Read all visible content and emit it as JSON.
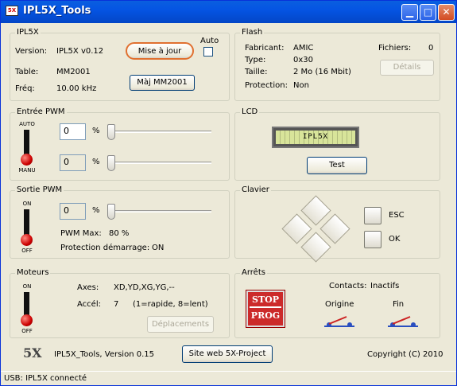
{
  "window": {
    "title": "IPL5X_Tools",
    "icon": "app-5x-icon"
  },
  "ipl5x": {
    "legend": "IPL5X",
    "version_label": "Version:",
    "version_value": "IPL5X v0.12",
    "update_button": "Mise à jour",
    "auto_label": "Auto",
    "auto_checked": false,
    "table_label": "Table:",
    "table_value": "MM2001",
    "freq_label": "Fréq:",
    "freq_value": "10.00 kHz",
    "maj_button": "Màj MM2001"
  },
  "flash": {
    "legend": "Flash",
    "fabricant_label": "Fabricant:",
    "fabricant_value": "AMIC",
    "type_label": "Type:",
    "type_value": "0x30",
    "taille_label": "Taille:",
    "taille_value": "2 Mo (16 Mbit)",
    "protection_label": "Protection:",
    "protection_value": "Non",
    "fichiers_label": "Fichiers:",
    "fichiers_value": "0",
    "details_button": "Détails"
  },
  "pwm_in": {
    "legend": "Entrée PWM",
    "toggle_top": "AUTO",
    "toggle_bottom": "MANU",
    "value1": "0",
    "value2": "0",
    "unit": "%",
    "level1": 0,
    "level2": 0
  },
  "lcd": {
    "legend": "LCD",
    "text": "IPL5X",
    "test_button": "Test"
  },
  "pwm_out": {
    "legend": "Sortie PWM",
    "toggle_top": "ON",
    "toggle_bottom": "OFF",
    "value": "0",
    "unit": "%",
    "level": 0,
    "max_label": "PWM Max:",
    "max_value": "80 %",
    "protect_label": "Protection démarrage:",
    "protect_value": "ON"
  },
  "keypad": {
    "legend": "Clavier",
    "esc_label": "ESC",
    "ok_label": "OK"
  },
  "motors": {
    "legend": "Moteurs",
    "toggle_top": "ON",
    "toggle_bottom": "OFF",
    "axes_label": "Axes:",
    "axes_value": "XD,YD,XG,YG,--",
    "accel_label": "Accél:",
    "accel_value": "7",
    "accel_hint": "(1=rapide, 8=lent)",
    "moves_button": "Déplacements"
  },
  "stops": {
    "legend": "Arrêts",
    "contacts_label": "Contacts:",
    "contacts_value": "Inactifs",
    "stop_line1": "STOP",
    "stop_line2": "PROG",
    "origin_label": "Origine",
    "end_label": "Fin"
  },
  "footer": {
    "logo": "5X",
    "version_text": "IPL5X_Tools, Version  0.15",
    "site_button": "Site web 5X-Project",
    "copyright": "Copyright (C) 2010"
  },
  "status": {
    "text": "USB: IPL5X connecté"
  },
  "colors": {
    "title_bar": "#0554e3",
    "stop_red": "#cc2a2a",
    "lcd_green": "#d8e49a",
    "highlight_orange": "#e07030"
  }
}
